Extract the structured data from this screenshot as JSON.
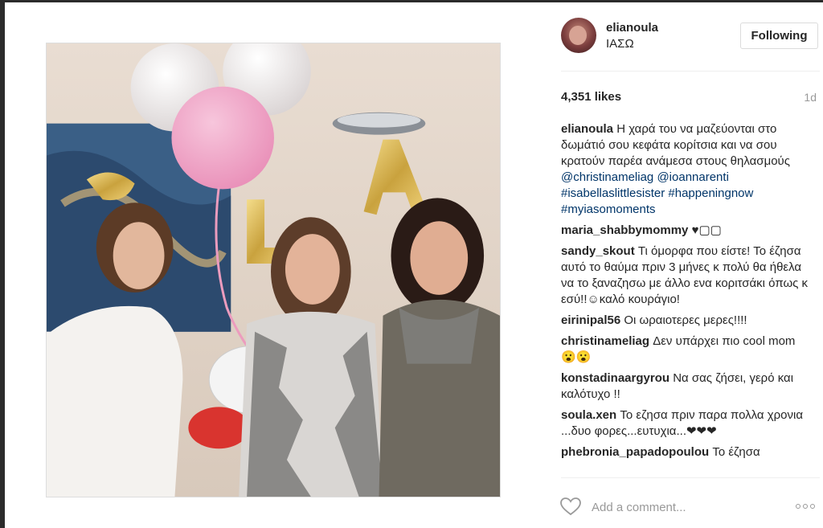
{
  "post": {
    "photo_alt": "",
    "balloon_letters": "IA"
  },
  "header": {
    "username": "elianoula",
    "location": "ΙΑΣΩ",
    "follow_label": "Following"
  },
  "stats": {
    "likes": "4,351 likes",
    "time": "1d"
  },
  "caption": {
    "author": "elianoula",
    "text": "Η χαρά του να μαζεύονται στο δωμάτιό σου κεφάτα κορίτσια και να σου κρατούν παρέα ανάμεσα στους θηλασμούς",
    "tags": [
      "@christinameliag",
      "@ioannarenti",
      "#isabellaslittlesister",
      "#happeningnow",
      "#myiasomoments"
    ]
  },
  "comments": [
    {
      "author": "maria_shabbymommy",
      "text": "♥▢▢"
    },
    {
      "author": "sandy_skout",
      "text": "Τι όμορφα που είστε! Το έζησα αυτό το θαύμα πριν 3 μήνες κ πολύ θα ήθελα να το ξαναζησω με άλλο ενα κοριτσάκι όπως κ εσύ!!☺καλό κουράγιο!"
    },
    {
      "author": "eirinipal56",
      "text": "Οι ωραιοτερες μερες!!!!"
    },
    {
      "author": "christinameliag",
      "text": "Δεν υπάρχει πιο cool mom 😮😮"
    },
    {
      "author": "konstadinaargyrou",
      "text": "Να σας ζήσει, γερό και καλότυχο !!"
    },
    {
      "author": "soula.xen",
      "text": "Το εζησα πριν παρα πολλα χρονια ...δυο φορες...ευτυχια...❤❤❤"
    },
    {
      "author": "phebronia_papadopoulou",
      "text": "Το έζησα"
    }
  ],
  "footer": {
    "like_icon": "heart-icon",
    "comment_placeholder": "Add a comment...",
    "more_icon": "more-options-icon"
  }
}
